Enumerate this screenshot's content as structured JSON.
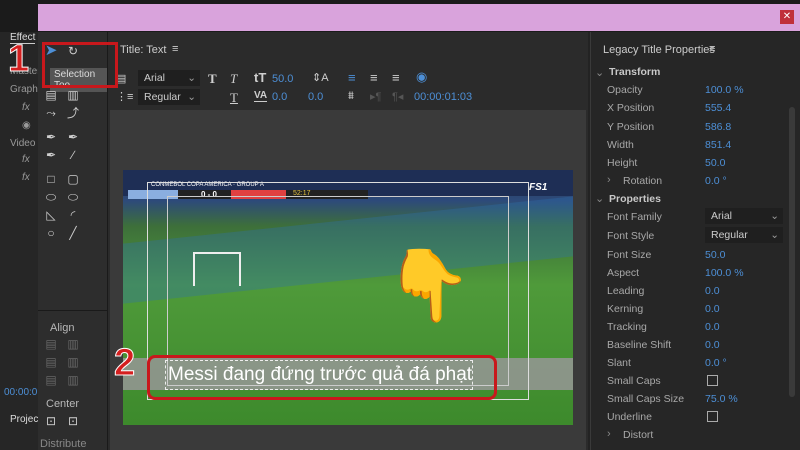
{
  "window": {
    "close_icon": "close-icon"
  },
  "left_panel": {
    "tab": "Effect",
    "items": [
      "Master",
      "Graph",
      "Video"
    ],
    "timecode": "00:00:0",
    "project_tab": "Projec"
  },
  "tools": {
    "tooltip": "Selection Too",
    "align_label": "Align",
    "center_label": "Center",
    "distribute_label": "Distribute"
  },
  "title_panel": {
    "title": "Title: Text",
    "font_family": "Arial",
    "font_style": "Regular",
    "font_size": "50.0",
    "kerning": "0.0",
    "leading": "0.0",
    "timecode": "00:00:01:03"
  },
  "video": {
    "scoreboard": "CONMEBOL COPA AMERICA · GROUP A",
    "score": "0 - 0",
    "clock": "52:17",
    "channel": "FS1",
    "caption": "Messi đang đứng trước quả đá phạt"
  },
  "annotations": {
    "step1": "1",
    "step2": "2"
  },
  "properties": {
    "title": "Legacy Title Properties",
    "transform_label": "Transform",
    "transform": [
      {
        "label": "Opacity",
        "value": "100.0 %"
      },
      {
        "label": "X Position",
        "value": "555.4"
      },
      {
        "label": "Y Position",
        "value": "586.8"
      },
      {
        "label": "Width",
        "value": "851.4"
      },
      {
        "label": "Height",
        "value": "50.0"
      },
      {
        "label": "Rotation",
        "value": "0.0 °"
      }
    ],
    "properties_label": "Properties",
    "font_family_label": "Font Family",
    "font_family": "Arial",
    "font_style_label": "Font Style",
    "font_style": "Regular",
    "props": [
      {
        "label": "Font Size",
        "value": "50.0"
      },
      {
        "label": "Aspect",
        "value": "100.0 %"
      },
      {
        "label": "Leading",
        "value": "0.0"
      },
      {
        "label": "Kerning",
        "value": "0.0"
      },
      {
        "label": "Tracking",
        "value": "0.0"
      },
      {
        "label": "Baseline Shift",
        "value": "0.0"
      },
      {
        "label": "Slant",
        "value": "0.0 °"
      }
    ],
    "small_caps_label": "Small Caps",
    "small_caps_size_label": "Small Caps Size",
    "small_caps_size": "75.0 %",
    "underline_label": "Underline",
    "distort_label": "Distort"
  },
  "colors": {
    "accent": "#4d8fd6",
    "annotation": "#d41f1f",
    "titlebar": "#d9a3dc"
  }
}
